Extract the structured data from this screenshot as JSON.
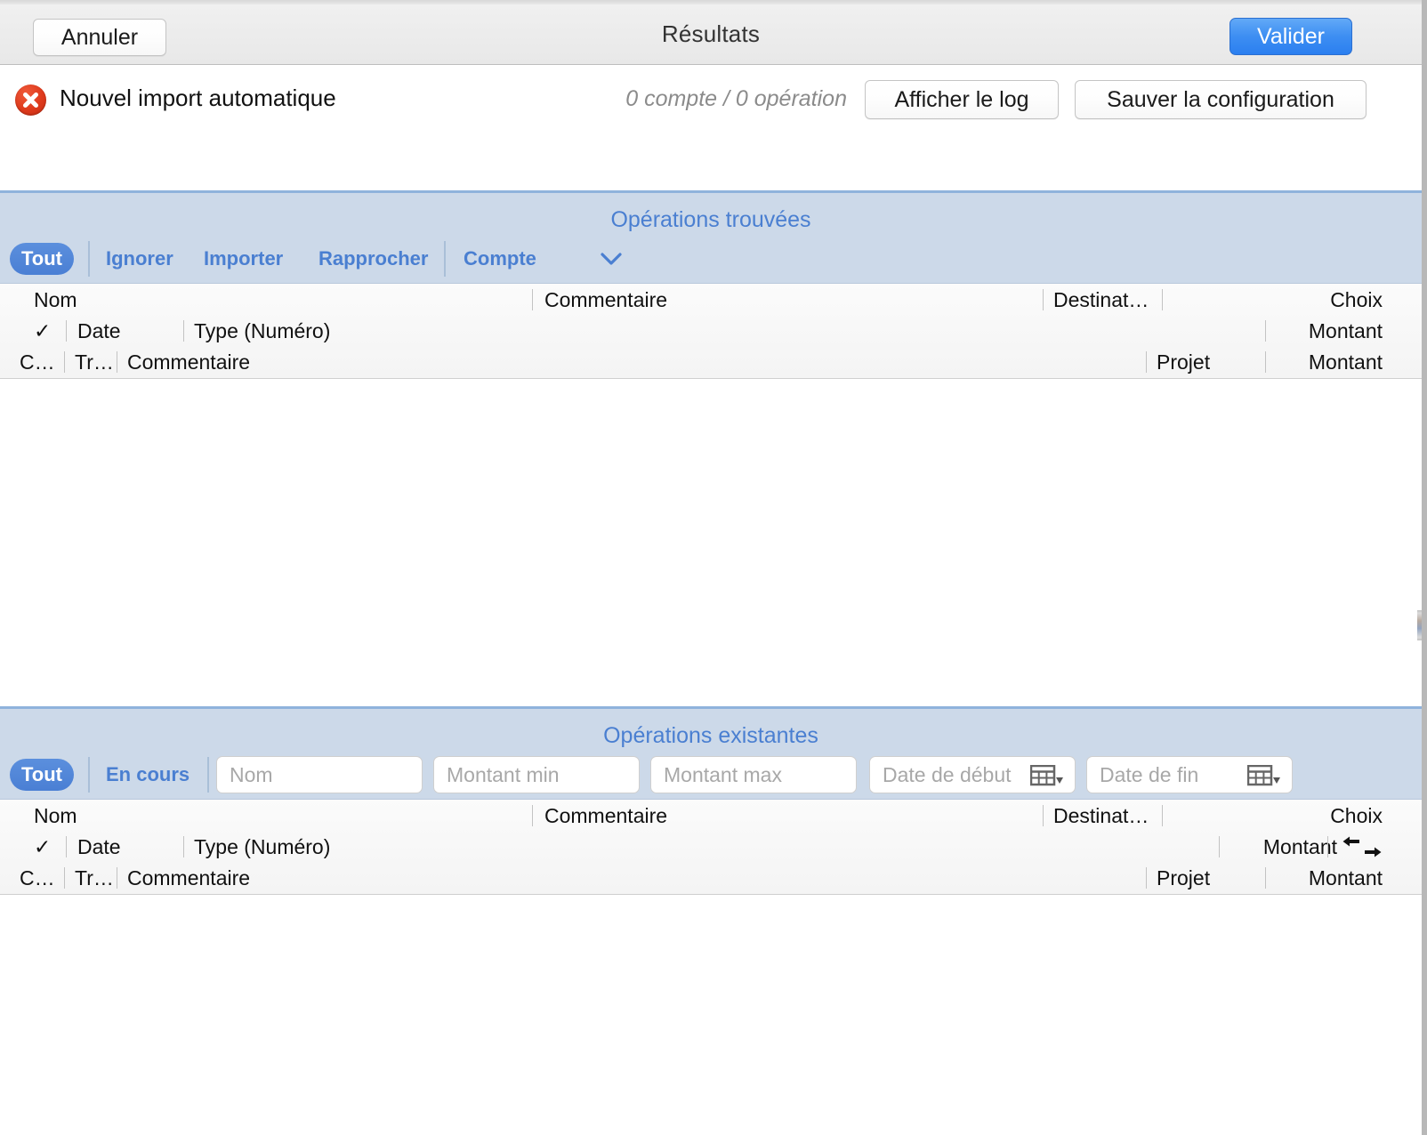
{
  "window": {
    "sheet_title": "Résultats",
    "cancel_label": "Annuler",
    "validate_label": "Valider"
  },
  "status": {
    "icon": "error-circle-x-icon",
    "import_name": "Nouvel import automatique",
    "counts": "0 compte / 0 opération",
    "show_log_label": "Afficher le log",
    "save_config_label": "Sauver la configuration"
  },
  "found_section": {
    "title": "Opérations trouvées",
    "toolbar": {
      "all_label": "Tout",
      "ignore_label": "Ignorer",
      "import_label": "Importer",
      "reconcile_label": "Rapprocher",
      "account_label": "Compte",
      "account_chevron": "chevron-down-icon"
    },
    "table": {
      "row1": [
        "Nom",
        "Commentaire",
        "Destinat…",
        "Choix"
      ],
      "row2_check": "✓",
      "row2": [
        "Date",
        "Type (Numéro)",
        "Montant"
      ],
      "row3": [
        "C…",
        "Tr…",
        "Commentaire",
        "Projet",
        "Montant"
      ]
    }
  },
  "existing_section": {
    "title": "Opérations existantes",
    "toolbar": {
      "all_label": "Tout",
      "ongoing_label": "En cours",
      "name_placeholder": "Nom",
      "amount_min_placeholder": "Montant min",
      "amount_max_placeholder": "Montant max",
      "date_start_placeholder": "Date de début",
      "date_end_placeholder": "Date de fin",
      "calendar_icon": "calendar-icon"
    },
    "table": {
      "row1": [
        "Nom",
        "Commentaire",
        "Destinat…",
        "Choix"
      ],
      "row2_check": "✓",
      "row2": [
        "Date",
        "Type (Numéro)",
        "Montant"
      ],
      "row2_swap_icon": "swap-arrows-icon",
      "row3": [
        "C…",
        "Tr…",
        "Commentaire",
        "Projet",
        "Montant"
      ]
    }
  },
  "colors": {
    "accent_blue": "#4a7fd1",
    "validate_blue": "#3d8ef2",
    "band_blue": "#ccd9e9",
    "error_red": "#de3a1c",
    "placeholder_gray": "#a8a8a8"
  }
}
